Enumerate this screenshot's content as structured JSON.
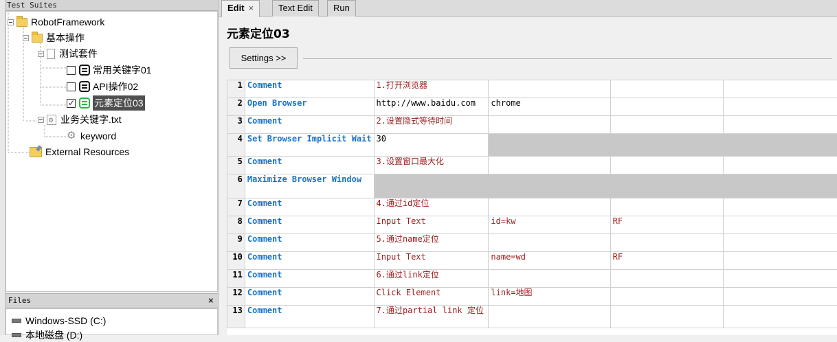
{
  "left_panel": {
    "header": "Test Suites",
    "tree": [
      {
        "label": "RobotFramework"
      },
      {
        "label": "基本操作"
      },
      {
        "label": "测试套件"
      },
      {
        "label": "常用关键字01"
      },
      {
        "label": "API操作02"
      },
      {
        "label": "元素定位03"
      },
      {
        "label": "业务关键字.txt"
      },
      {
        "label": "keyword"
      },
      {
        "label": "External Resources"
      }
    ]
  },
  "files_panel": {
    "header": "Files",
    "close": "×",
    "drives": [
      {
        "label": "Windows-SSD (C:)"
      },
      {
        "label": "本地磁盘 (D:)"
      }
    ]
  },
  "tabs": [
    {
      "label": "Edit",
      "close": "×"
    },
    {
      "label": "Text Edit"
    },
    {
      "label": "Run"
    }
  ],
  "editor": {
    "title": "元素定位03",
    "settings_label": "Settings >>"
  },
  "grid": {
    "rows": [
      {
        "num": "1",
        "c1": "Comment",
        "c2": "1.打开浏览器",
        "c3": "",
        "c4": ""
      },
      {
        "num": "2",
        "c1": "Open Browser",
        "c2": "http://www.baidu.com",
        "c3": "chrome",
        "c4": ""
      },
      {
        "num": "3",
        "c1": "Comment",
        "c2": "2.设置隐式等待时间",
        "c3": "",
        "c4": ""
      },
      {
        "num": "4",
        "c1": "Set Browser Implicit Wait",
        "c2": "30",
        "c3": "",
        "c4": ""
      },
      {
        "num": "5",
        "c1": "Comment",
        "c2": "3.设置窗口最大化",
        "c3": "",
        "c4": ""
      },
      {
        "num": "6",
        "c1": "Maximize Browser Window",
        "c2": "",
        "c3": "",
        "c4": ""
      },
      {
        "num": "7",
        "c1": "Comment",
        "c2": "4.通过id定位",
        "c3": "",
        "c4": ""
      },
      {
        "num": "8",
        "c1": "Comment",
        "c2": "Input Text",
        "c3": "id=kw",
        "c4": "RF"
      },
      {
        "num": "9",
        "c1": "Comment",
        "c2": "5.通过name定位",
        "c3": "",
        "c4": ""
      },
      {
        "num": "10",
        "c1": "Comment",
        "c2": "Input Text",
        "c3": "name=wd",
        "c4": "RF"
      },
      {
        "num": "11",
        "c1": "Comment",
        "c2": "6.通过link定位",
        "c3": "",
        "c4": ""
      },
      {
        "num": "12",
        "c1": "Comment",
        "c2": "Click Element",
        "c3": "link=地图",
        "c4": ""
      },
      {
        "num": "13",
        "c1": "Comment",
        "c2": "7.通过partial link 定位",
        "c3": "",
        "c4": ""
      }
    ]
  },
  "colors": {
    "keyword": "#1a73c7",
    "comment": "#9b1c1c",
    "empty_cell": "#c8c8c8",
    "selection": "#4f4f4f"
  }
}
